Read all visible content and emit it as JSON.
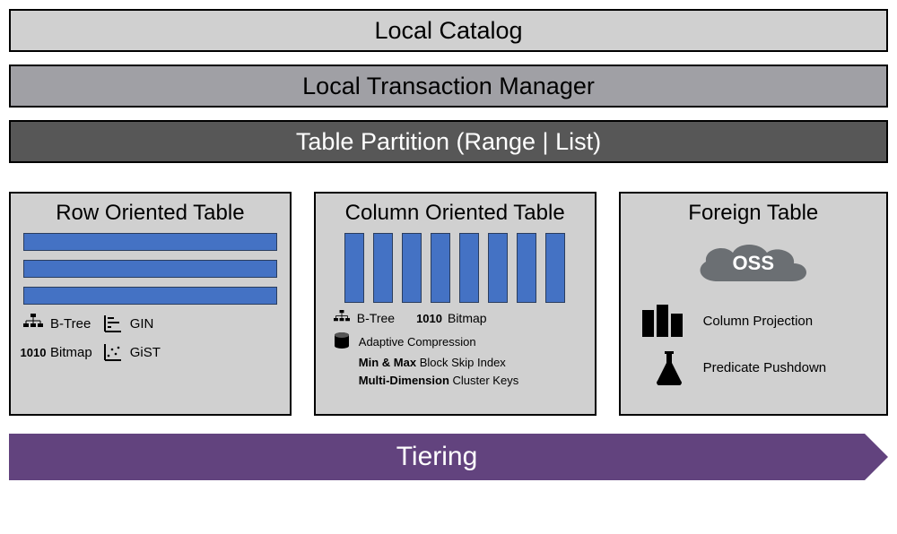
{
  "layers": {
    "local_catalog": "Local Catalog",
    "local_txn_mgr": "Local Transaction Manager",
    "table_partition": "Table Partition (Range | List)"
  },
  "tables": {
    "row": {
      "title": "Row Oriented Table",
      "features": {
        "btree": "B-Tree",
        "gin": "GIN",
        "bitmap_code": "1010",
        "bitmap": "Bitmap",
        "gist": "GiST"
      }
    },
    "column": {
      "title": "Column Oriented Table",
      "top": {
        "btree": "B-Tree",
        "bitmap_code": "1010",
        "bitmap": "Bitmap"
      },
      "features": {
        "adaptive": "Adaptive Compression",
        "minmax_bold": "Min & Max",
        "minmax_rest": " Block Skip Index",
        "multidim_bold": "Multi-Dimension",
        "multidim_rest": " Cluster Keys"
      }
    },
    "foreign": {
      "title": "Foreign Table",
      "oss": "OSS",
      "features": {
        "col_proj": "Column Projection",
        "pred_push": "Predicate Pushdown"
      }
    }
  },
  "tiering": "Tiering"
}
